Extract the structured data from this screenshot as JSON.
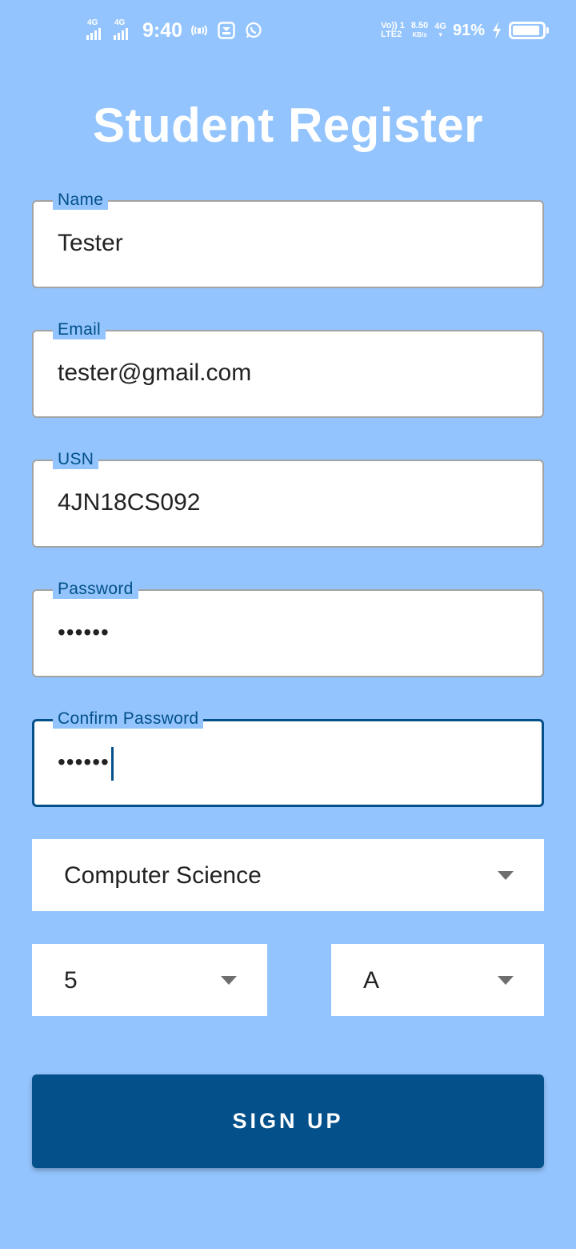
{
  "status_bar": {
    "sim1_tag": "4G",
    "sim2_tag": "4G",
    "time": "9:40",
    "volte_line1": "Vo)) 1",
    "volte_line2": "LTE2",
    "speed_value": "8.50",
    "speed_unit": "KB/s",
    "network_tag": "4G",
    "battery_percent": "91%",
    "battery_level": 0.91
  },
  "page": {
    "title": "Student Register"
  },
  "form": {
    "name": {
      "label": "Name",
      "value": "Tester"
    },
    "email": {
      "label": "Email",
      "value": "tester@gmail.com"
    },
    "usn": {
      "label": "USN",
      "value": "4JN18CS092"
    },
    "password": {
      "label": "Password",
      "value": "••••••"
    },
    "confirm_password": {
      "label": "Confirm Password",
      "value": "••••••"
    },
    "department": {
      "selected": "Computer Science"
    },
    "semester": {
      "selected": "5"
    },
    "section": {
      "selected": "A"
    },
    "signup_label": "SIGN UP"
  },
  "colors": {
    "background": "#93c4fd",
    "accent": "#03508a",
    "field_bg": "#ffffff",
    "border": "#a3a3a3"
  }
}
